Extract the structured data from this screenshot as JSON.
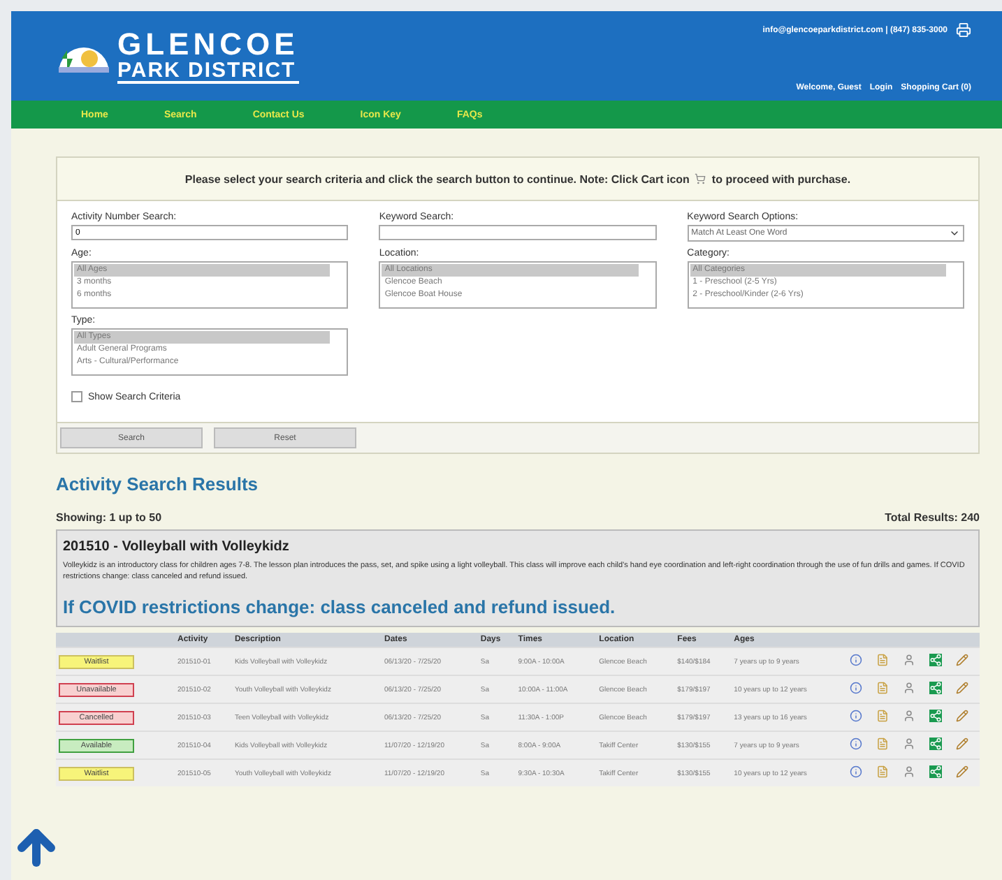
{
  "header": {
    "logo_line1": "GLENCOE",
    "logo_line2": "PARK DISTRICT",
    "contact": "info@glencoeparkdistrict.com | (847) 835-3000",
    "welcome": "Welcome, Guest",
    "login": "Login",
    "cart": "Shopping Cart (0)"
  },
  "nav": [
    "Home",
    "Search",
    "Contact Us",
    "Icon Key",
    "FAQs"
  ],
  "notice": {
    "before": "Please select your search criteria and click the search button to continue. Note: Click Cart icon",
    "after": "to proceed with purchase."
  },
  "fields": [
    {
      "kind": "input",
      "label": "Activity Number Search:",
      "value": "0"
    },
    {
      "kind": "input",
      "label": "Keyword Search:"
    },
    {
      "kind": "select",
      "label": "Keyword Search Options:",
      "value": "Match At Least One Word"
    },
    {
      "kind": "list",
      "label": "Age:",
      "options": [
        {
          "label": "All Ages",
          "selected": true
        },
        {
          "label": "3 months",
          "selected": false
        },
        {
          "label": "6 months",
          "selected": false
        }
      ]
    },
    {
      "kind": "list",
      "label": "Location:",
      "options": [
        {
          "label": "All Locations",
          "selected": true
        },
        {
          "label": "Glencoe Beach",
          "selected": false
        },
        {
          "label": "Glencoe Boat House",
          "selected": false
        }
      ]
    },
    {
      "kind": "list",
      "label": "Category:",
      "options": [
        {
          "label": "All Categories",
          "selected": true
        },
        {
          "label": "1 - Preschool (2-5 Yrs)",
          "selected": false
        },
        {
          "label": "2 - Preschool/Kinder (2-6 Yrs)",
          "selected": false
        }
      ]
    },
    {
      "kind": "list",
      "label": "Type:",
      "options": [
        {
          "label": "All Types",
          "selected": true
        },
        {
          "label": "Adult General Programs",
          "selected": false
        },
        {
          "label": "Arts - Cultural/Performance",
          "selected": false
        }
      ]
    }
  ],
  "show_criteria": {
    "label": "Show Search Criteria",
    "checked": false
  },
  "buttons": [
    "Search",
    "Reset"
  ],
  "results": {
    "title": "Activity Search Results",
    "showing": "Showing: 1 up to 50",
    "total": "Total Results: 240"
  },
  "activity": {
    "title": "201510 - Volleyball with Volleykidz",
    "description": "Volleykidz is an introductory class for children ages 7-8. The lesson plan introduces the pass, set, and spike using a light volleyball. This class will improve each child's hand eye coordination and left-right coordination through the use of fun drills and games. If COVID restrictions change: class canceled and refund issued.",
    "notice": "If COVID restrictions change: class canceled and refund issued."
  },
  "table": {
    "columns": [
      "Activity",
      "Description",
      "Dates",
      "Days",
      "Times",
      "Location",
      "Fees",
      "Ages"
    ],
    "rows": [
      {
        "status": "Waitlist",
        "kind": "waitlist",
        "cells": [
          "201510-01",
          "Kids Volleyball with Volleykidz",
          "06/13/20 - 7/25/20",
          "Sa",
          "9:00A - 10:00A",
          "Glencoe Beach",
          "$140/$184",
          "7 years up to 9 years"
        ]
      },
      {
        "status": "Unavailable",
        "kind": "unavailable",
        "cells": [
          "201510-02",
          "Youth Volleyball with Volleykidz",
          "06/13/20 - 7/25/20",
          "Sa",
          "10:00A - 11:00A",
          "Glencoe Beach",
          "$179/$197",
          "10 years up to 12 years"
        ]
      },
      {
        "status": "Cancelled",
        "kind": "cancelled",
        "cells": [
          "201510-03",
          "Teen Volleyball with Volleykidz",
          "06/13/20 - 7/25/20",
          "Sa",
          "11:30A - 1:00P",
          "Glencoe Beach",
          "$179/$197",
          "13 years up to 16 years"
        ]
      },
      {
        "status": "Available",
        "kind": "available",
        "cells": [
          "201510-04",
          "Kids Volleyball with Volleykidz",
          "11/07/20 - 12/19/20",
          "Sa",
          "8:00A - 9:00A",
          "Takiff Center",
          "$130/$155",
          "7 years up to 9 years"
        ]
      },
      {
        "status": "Waitlist",
        "kind": "waitlist",
        "cells": [
          "201510-05",
          "Youth Volleyball with Volleykidz",
          "11/07/20 - 12/19/20",
          "Sa",
          "9:30A - 10:30A",
          "Takiff Center",
          "$130/$155",
          "10 years up to 12 years"
        ]
      }
    ]
  }
}
